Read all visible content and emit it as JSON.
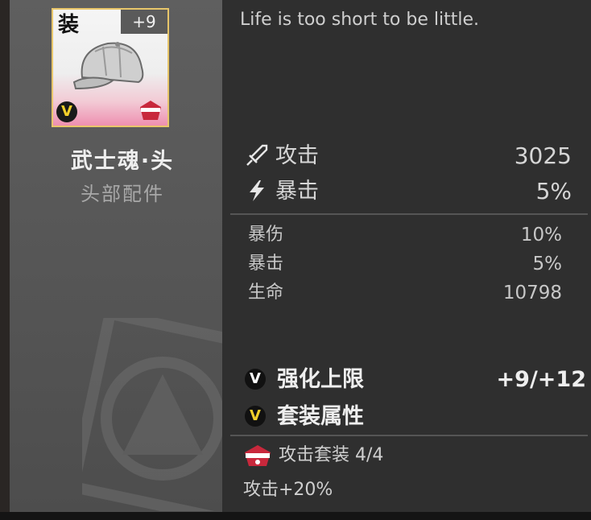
{
  "item": {
    "tag": "装",
    "level": "+9",
    "rarity_badge": "V",
    "name": "武士魂·头",
    "type": "头部配件",
    "image_icon": "cap-icon"
  },
  "flavor_text": "Life is too short to be little.",
  "main_stats": [
    {
      "label": "攻击",
      "value": "3025",
      "icon": "sword-icon"
    },
    {
      "label": "暴击",
      "value": "5%",
      "icon": "lightning-icon"
    }
  ],
  "sub_stats": [
    {
      "label": "暴伤",
      "value": "10%"
    },
    {
      "label": "暴击",
      "value": "5%"
    },
    {
      "label": "生命",
      "value": "10798"
    }
  ],
  "enhance": {
    "label": "强化上限",
    "value": "+9/+12",
    "badge": "V"
  },
  "set_attr": {
    "label": "套装属性",
    "badge": "V"
  },
  "set_effect": {
    "label": "攻击套装 4/4",
    "icon": "attack-set-icon",
    "bonus": "攻击+20%"
  },
  "colors": {
    "card_border": "#e8c66a",
    "badge_yellow": "#f2cf2a",
    "badge_white": "#ffffff",
    "set_red": "#c8283c"
  }
}
